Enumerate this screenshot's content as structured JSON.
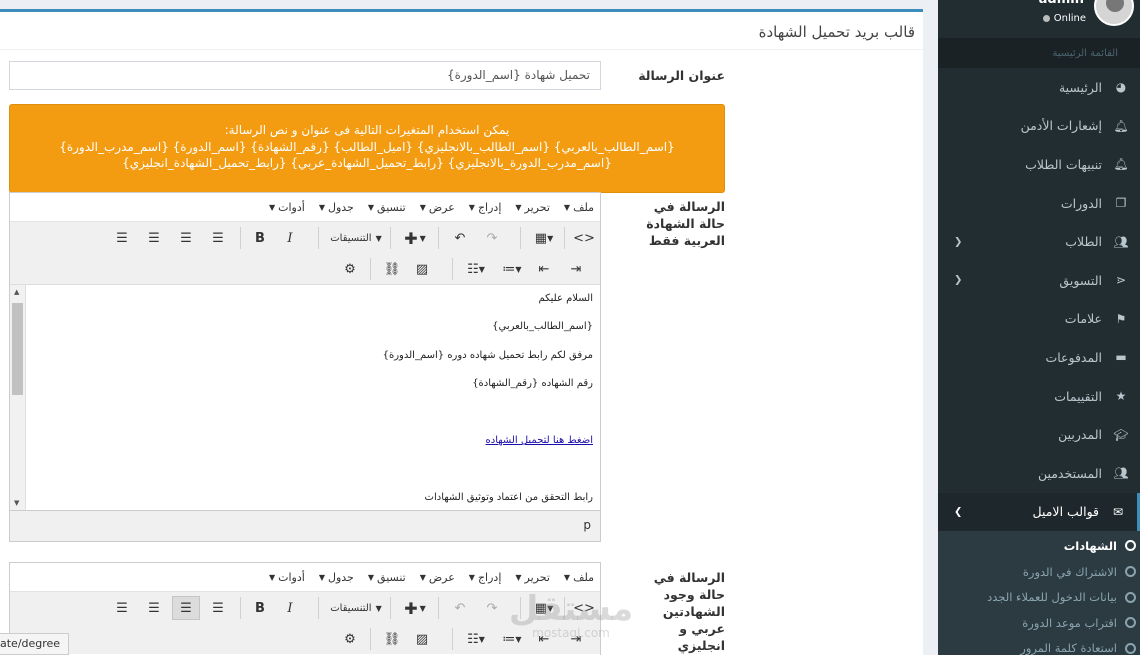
{
  "page": {
    "title": "قالب بريد تحميل الشهادة",
    "url_tooltip": "ate/degree",
    "watermark": {
      "text": "مستقل",
      "sub": "mostaql.com"
    }
  },
  "form": {
    "subject_label": "عنوان الرسالة",
    "subject_value": "تحميل شهادة {اسم_الدورة}",
    "alert_lines": [
      "يمكن استخدام المتغيرات التالية فى عنوان و نص الرسالة:",
      "{اسم_الطالب_بالعربي} {اسم_الطالب_بالانجليزي} {اميل_الطالب} {رقم_الشهادة} {اسم_الدورة} {اسم_مدرب_الدورة}",
      "{اسم_مدرب_الدورة_بالانجليزي} {رابط_تحميل_الشهادة_عربي} {رابط_تحميل_الشهادة_انجليزي}"
    ],
    "arabic_label": "الرسالة في حالة الشهادة العربية فقط",
    "bilingual_label": "الرسالة في حالة وجود الشهادتين عربي و انجليزي"
  },
  "editor": {
    "menu": [
      "ملف",
      "تحرير",
      "إدراج",
      "عرض",
      "تنسيق",
      "جدول",
      "أدوات"
    ],
    "formats_label": "التنسيقات",
    "status_path": "p",
    "content": {
      "line1": "السلام عليكم",
      "line2": "{اسم_الطالب_بالعربي}",
      "line3": "مرفق لكم رابط تحميل شهاده دوره {اسم_الدورة}",
      "line4": "رقم الشهاده  {رقم_الشهادة}",
      "link": "اضغط هنا لتحميل الشهاده",
      "line6": "رابط التحقق من اعتماد وتوثيق الشهادات"
    }
  },
  "user": {
    "name": "admin",
    "status": "Online"
  },
  "sidebar": {
    "header": "القائمة الرئيسية",
    "items": [
      {
        "label": "الرئيسية",
        "icon": "dashboard-icon"
      },
      {
        "label": "إشعارات الأدمن",
        "icon": "bell-icon"
      },
      {
        "label": "تنبيهات الطلاب",
        "icon": "bell-icon"
      },
      {
        "label": "الدورات",
        "icon": "copy-icon"
      },
      {
        "label": "الطلاب",
        "icon": "users-icon"
      },
      {
        "label": "التسويق",
        "icon": "share-icon"
      },
      {
        "label": "علامات",
        "icon": "signs-icon"
      },
      {
        "label": "المدفوعات",
        "icon": "money-icon"
      },
      {
        "label": "التقييمات",
        "icon": "star-icon"
      },
      {
        "label": "المدربين",
        "icon": "graduation-cap-icon"
      },
      {
        "label": "المستخدمين",
        "icon": "users-icon"
      },
      {
        "label": "قوالب الاميل",
        "icon": "envelope-icon"
      }
    ],
    "subitems": [
      {
        "label": "الشهادات"
      },
      {
        "label": "الاشتراك في الدورة"
      },
      {
        "label": "بيانات الدخول للعملاء الجدد"
      },
      {
        "label": "اقتراب موعد الدورة"
      },
      {
        "label": "استعادة كلمة المرور"
      }
    ]
  }
}
